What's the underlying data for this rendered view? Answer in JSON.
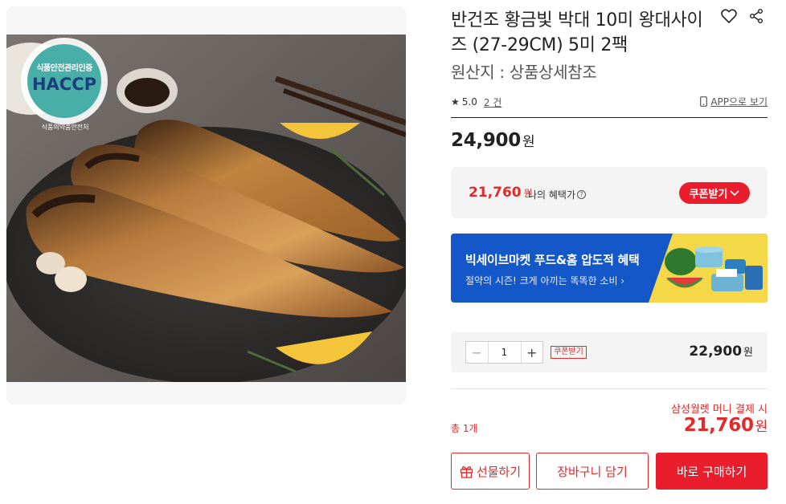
{
  "product": {
    "title": "반건조 황금빛 박대 10미 왕대사이즈 (27-29CM) 5미 2팩",
    "origin": "원산지 : 상품상세참조",
    "rating": "5.0",
    "review_count": "2 건",
    "app_link": "APP으로 보기",
    "price": "24,900",
    "currency": "원"
  },
  "image": {
    "badge_top": "식품안전관리인증",
    "badge_main": "HACCP",
    "badge_bottom": "식품의약품안전처"
  },
  "benefit": {
    "price": "21,760",
    "currency": "원",
    "label": "나의 혜택가",
    "info_icon": "?",
    "coupon_button": "쿠폰받기"
  },
  "banner": {
    "title": "빅세이브마켓 푸드&홈 압도적 혜택",
    "subtitle": "절약의 시즌! 크게 아끼는 똑똑한 소비 ›"
  },
  "option": {
    "minus": "−",
    "plus": "+",
    "quantity": "1",
    "coupon_tag": "쿠폰받기",
    "price": "22,900",
    "currency": "원"
  },
  "summary": {
    "pay_note": "삼성월렛 머니 결제 시",
    "total_label": "총 1개",
    "total_price": "21,760",
    "currency": "원"
  },
  "buttons": {
    "gift": "선물하기",
    "cart": "장바구니 담기",
    "buy": "바로 구매하기"
  },
  "colors": {
    "accent": "#ea1d2c",
    "banner": "#1457c8",
    "panel": "#f4f4f4"
  },
  "icons": [
    "heart-icon",
    "share-icon",
    "star-icon",
    "mobile-icon",
    "info-icon",
    "chevron-down-icon",
    "gift-icon"
  ]
}
